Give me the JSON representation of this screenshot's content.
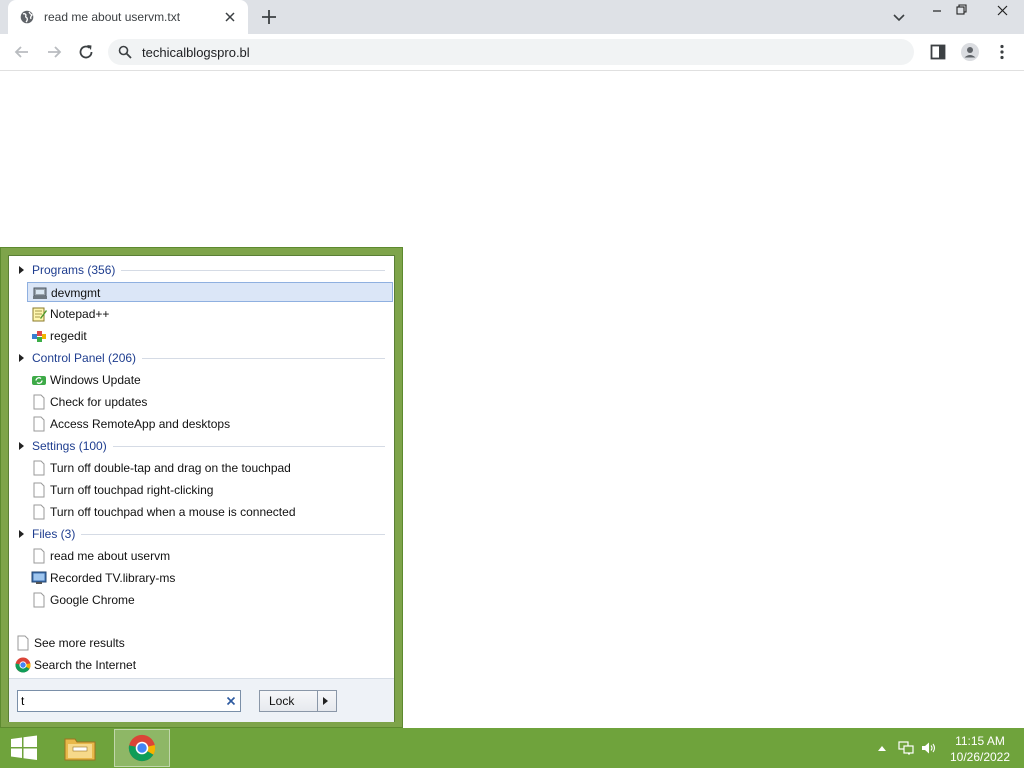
{
  "browser": {
    "tab_title": "read me about uservm.txt",
    "url": "techicalblogspro.bl",
    "icons": [
      "globe-icon",
      "close-icon",
      "plus-icon",
      "chevron-down-icon",
      "minimize-icon",
      "restore-icon",
      "window-close-icon",
      "back-icon",
      "forward-icon",
      "reload-icon",
      "search-icon",
      "side-panel-icon",
      "profile-icon",
      "kebab-menu-icon"
    ]
  },
  "start_search": {
    "groups": [
      {
        "title": "Programs (356)",
        "items": [
          "devmgmt",
          "Notepad++",
          "regedit"
        ]
      },
      {
        "title": "Control Panel (206)",
        "items": [
          "Windows Update",
          "Check for updates",
          "Access RemoteApp and desktops"
        ]
      },
      {
        "title": "Settings (100)",
        "items": [
          "Turn off double-tap and drag on the touchpad",
          "Turn off touchpad right-clicking",
          "Turn off touchpad when a mouse is connected"
        ]
      },
      {
        "title": "Files (3)",
        "items": [
          "read me about uservm",
          "Recorded TV.library-ms",
          "Google Chrome"
        ]
      }
    ],
    "selected_item": "devmgmt",
    "see_more": "See more results",
    "search_internet": "Search the Internet",
    "search_value": "t",
    "lock_label": "Lock"
  },
  "taskbar": {
    "time": "11:15 AM",
    "date": "10/26/2022",
    "apps": [
      "file-explorer-icon",
      "chrome-icon"
    ],
    "accent": "#6fa33c"
  }
}
